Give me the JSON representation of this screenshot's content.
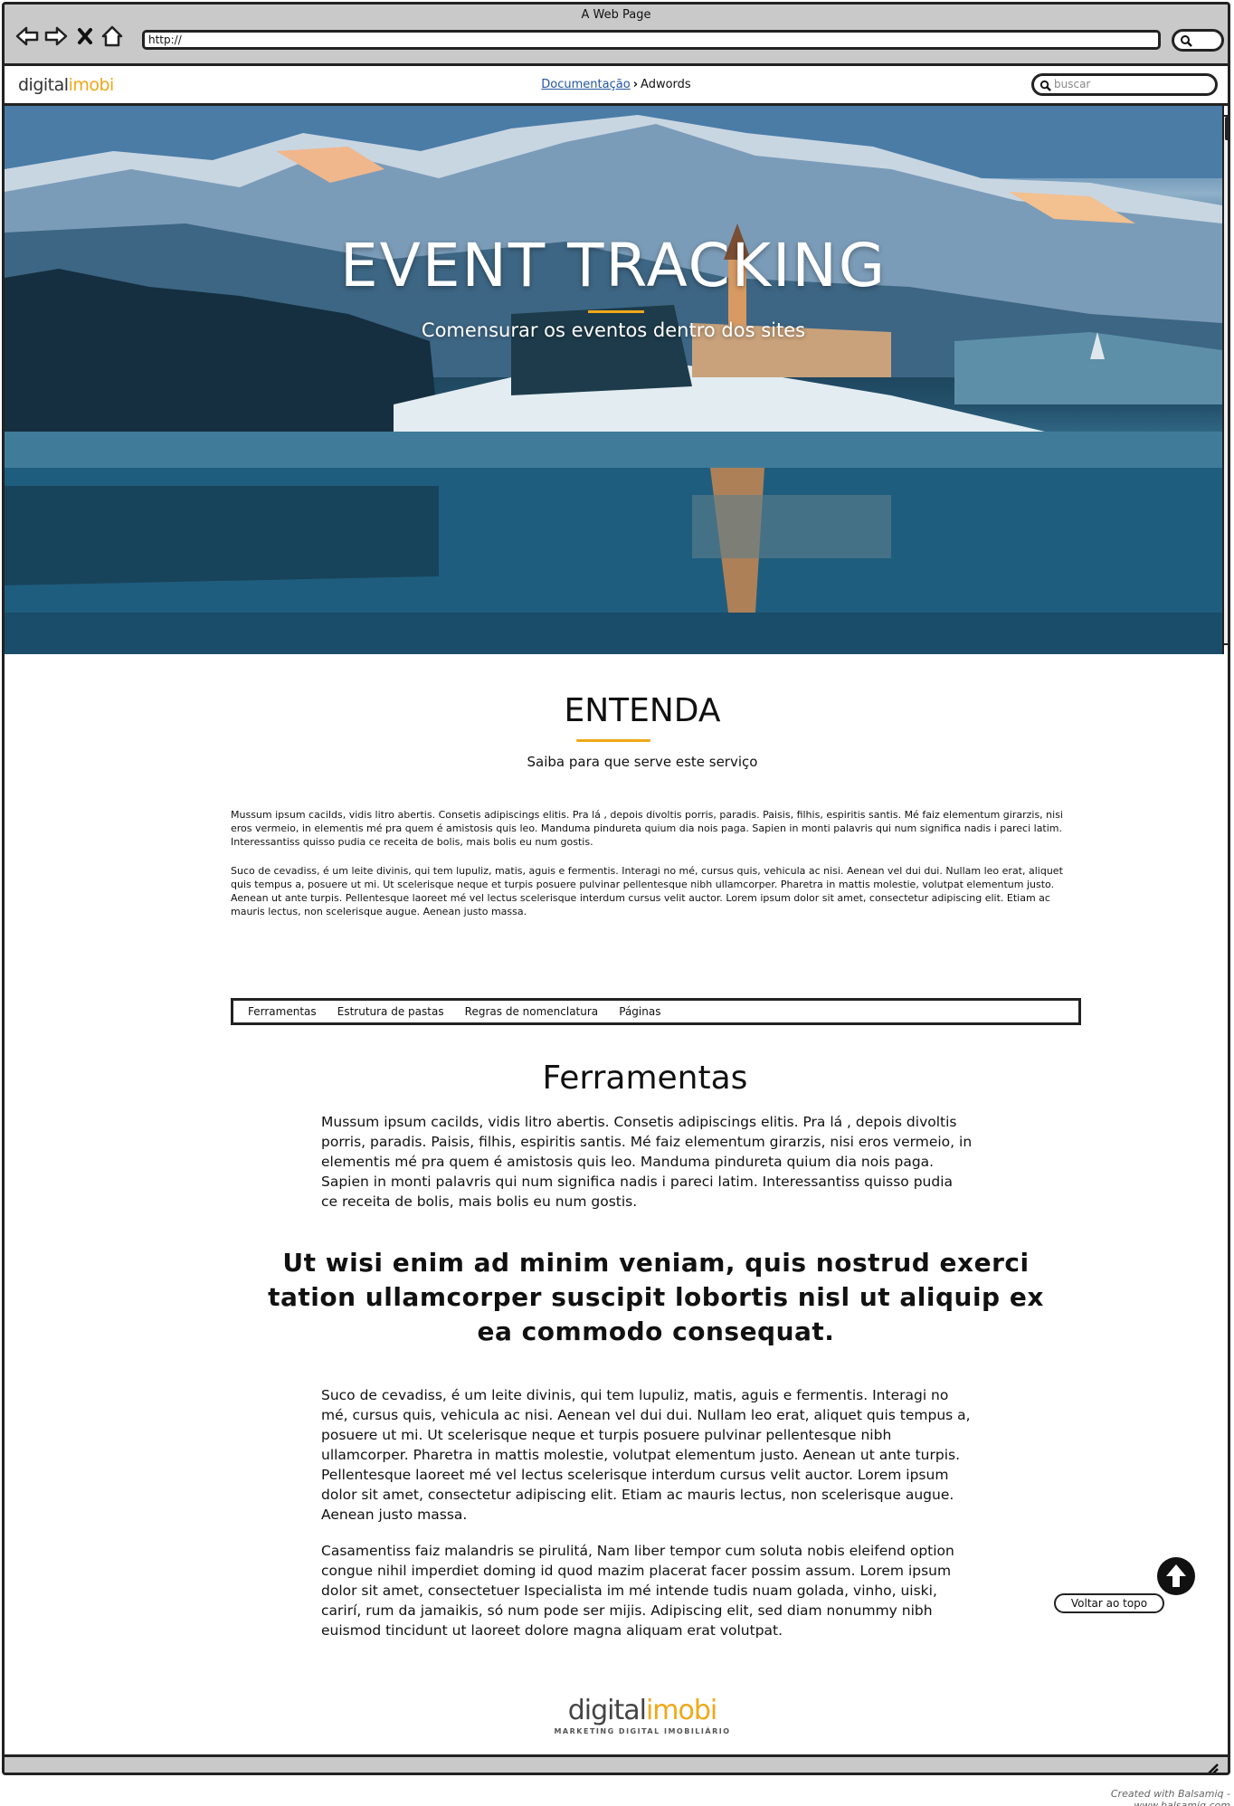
{
  "window": {
    "title": "A Web Page",
    "url": "http://"
  },
  "header": {
    "logo_a": "digital",
    "logo_b": "imobi",
    "breadcrumb_link": "Documentação",
    "breadcrumb_current": "Adwords",
    "search_placeholder": "buscar"
  },
  "hero": {
    "title": "EVENT TRACKING",
    "subtitle": "Comensurar os eventos dentro dos sites"
  },
  "entenda": {
    "title": "ENTENDA",
    "subtitle": "Saiba para que serve este serviço",
    "p1": "Mussum ipsum cacilds, vidis litro abertis. Consetis adipiscings elitis. Pra lá , depois divoltis porris, paradis. Paisis, filhis, espiritis santis. Mé faiz elementum girarzis, nisi eros vermeio, in elementis mé pra quem é amistosis quis leo. Manduma pindureta quium dia nois paga. Sapien in monti palavris qui num significa nadis i pareci latim. Interessantiss quisso pudia ce receita de bolis, mais bolis eu num gostis.",
    "p2": "Suco de cevadiss, é um leite divinis, qui tem lupuliz, matis, aguis e fermentis. Interagi no mé, cursus quis, vehicula ac nisi. Aenean vel dui dui. Nullam leo erat, aliquet quis tempus a, posuere ut mi. Ut scelerisque neque et turpis posuere pulvinar pellentesque nibh ullamcorper. Pharetra in mattis molestie, volutpat elementum justo. Aenean ut ante turpis. Pellentesque laoreet mé vel lectus scelerisque interdum cursus velit auctor. Lorem ipsum dolor sit amet, consectetur adipiscing elit. Etiam ac mauris lectus, non scelerisque augue. Aenean justo massa."
  },
  "tabs": [
    "Ferramentas",
    "Estrutura de pastas",
    "Regras de nomenclatura",
    "Páginas"
  ],
  "ferramentas": {
    "title": "Ferramentas",
    "p1": "Mussum ipsum cacilds, vidis litro abertis. Consetis adipiscings elitis. Pra lá , depois divoltis porris, paradis. Paisis, filhis, espiritis santis. Mé faiz elementum girarzis, nisi eros vermeio, in elementis mé pra quem é amistosis quis leo. Manduma pindureta quium dia nois paga. Sapien in monti palavris qui num significa nadis i pareci latim. Interessantiss quisso pudia ce receita de bolis, mais bolis eu num gostis.",
    "quote": "Ut wisi enim ad minim veniam, quis nostrud exerci tation ullamcorper suscipit lobortis nisl ut aliquip ex ea commodo consequat.",
    "p2": "Suco de cevadiss, é um leite divinis, qui tem lupuliz, matis, aguis e fermentis. Interagi no mé, cursus quis, vehicula ac nisi. Aenean vel dui dui. Nullam leo erat, aliquet quis tempus a, posuere ut mi. Ut scelerisque neque et turpis posuere pulvinar pellentesque nibh ullamcorper. Pharetra in mattis molestie, volutpat elementum justo. Aenean ut ante turpis. Pellentesque laoreet mé vel lectus scelerisque interdum cursus velit auctor. Lorem ipsum dolor sit amet, consectetur adipiscing elit. Etiam ac mauris lectus, non scelerisque augue. Aenean justo massa.",
    "p3": "Casamentiss faiz malandris se pirulitá, Nam liber tempor cum soluta nobis eleifend option congue nihil imperdiet doming id quod mazim placerat facer possim assum. Lorem ipsum dolor sit amet, consectetuer Ispecialista im mé intende tudis nuam golada, vinho, uiski, carirí, rum da jamaikis, só num pode ser mijis. Adipiscing elit, sed diam nonummy nibh euismod tincidunt ut laoreet dolore magna aliquam erat volutpat."
  },
  "back_to_top": "Voltar ao topo",
  "footer": {
    "logo_a": "digital",
    "logo_b": "imobi",
    "tagline": "MARKETING DIGITAL IMOBILIÁRIO"
  },
  "credit": "Created with Balsamiq - www.balsamiq.com",
  "colors": {
    "accent": "#f0a818",
    "link": "#2456a0",
    "chrome": "#c9c9c9"
  }
}
